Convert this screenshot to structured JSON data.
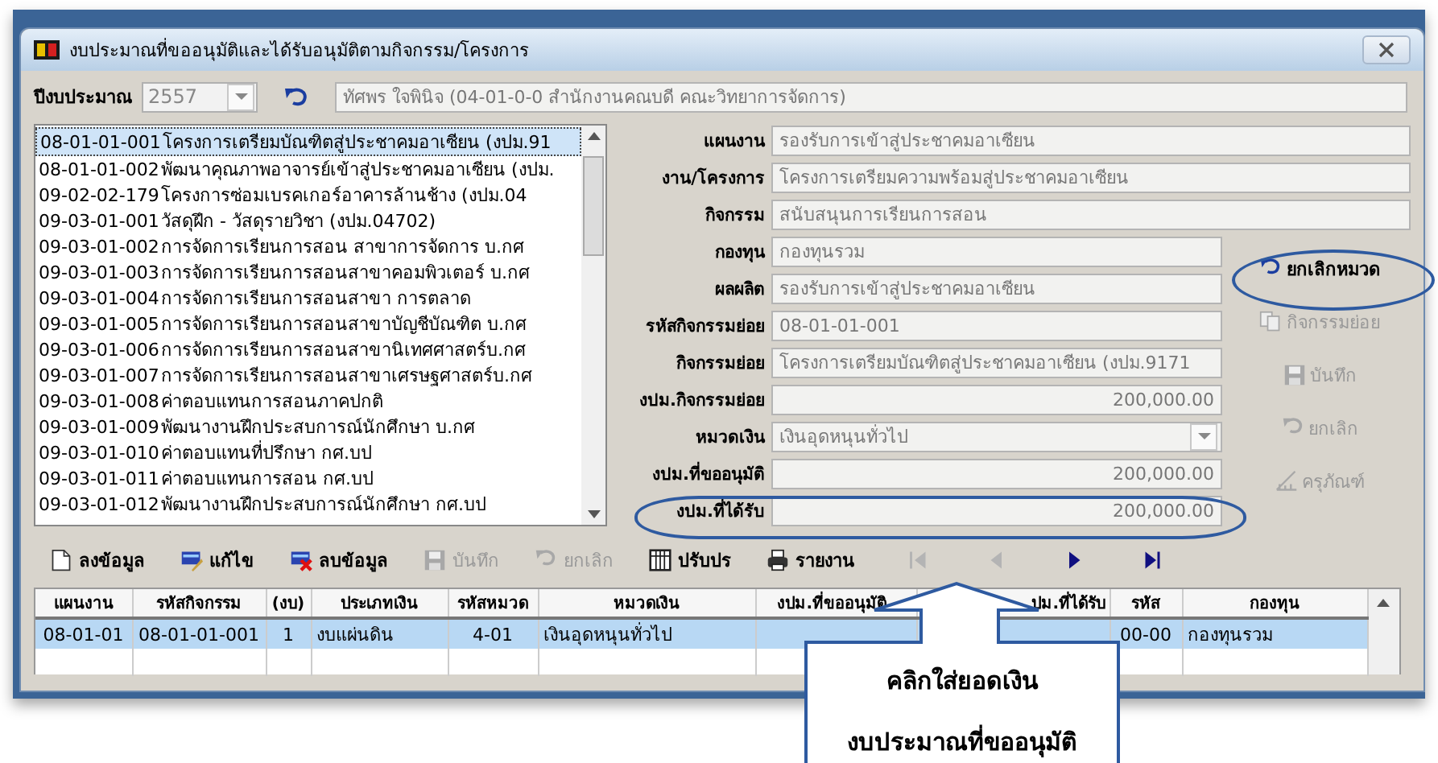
{
  "window": {
    "title": "งบประมาณที่ขออนุมัติและได้รับอนุมัติตามกิจกรรม/โครงการ"
  },
  "budget_year": {
    "label": "ปีงบประมาณ",
    "value": "2557",
    "user": "ทัศพร ใจพินิจ  (04-01-0-0 สำนักงานคณบดี คณะวิทยาการจัดการ)"
  },
  "activity_list": [
    {
      "code": "08-01-01-001",
      "name": "โครงการเตรียมบัณฑิตสู่ประชาคมอาเซียน (งปม.91",
      "selected": true
    },
    {
      "code": "08-01-01-002",
      "name": "พัฒนาคุณภาพอาจารย์เข้าสู่ประชาคมอาเซียน (งปม.",
      "selected": false
    },
    {
      "code": "09-02-02-179",
      "name": "โครงการซ่อมเบรคเกอร์อาคารล้านช้าง (งปม.04",
      "selected": false
    },
    {
      "code": "09-03-01-001",
      "name": "วัสดุฝึก - วัสดุรายวิชา (งปม.04702)",
      "selected": false
    },
    {
      "code": "09-03-01-002",
      "name": "การจัดการเรียนการสอน สาขาการจัดการ บ.กศ",
      "selected": false
    },
    {
      "code": "09-03-01-003",
      "name": "การจัดการเรียนการสอนสาขาคอมพิวเตอร์ บ.กศ",
      "selected": false
    },
    {
      "code": "09-03-01-004",
      "name": "การจัดการเรียนการสอนสาขา การตลาด",
      "selected": false
    },
    {
      "code": "09-03-01-005",
      "name": "การจัดการเรียนการสอนสาขาบัญชีบัณฑิต บ.กศ",
      "selected": false
    },
    {
      "code": "09-03-01-006",
      "name": "การจัดการเรียนการสอนสาขานิเทศศาสตร์บ.กศ",
      "selected": false
    },
    {
      "code": "09-03-01-007",
      "name": "การจัดการเรียนการสอนสาขาเศรษฐศาสตร์บ.กศ",
      "selected": false
    },
    {
      "code": "09-03-01-008",
      "name": "ค่าตอบแทนการสอนภาคปกติ",
      "selected": false
    },
    {
      "code": "09-03-01-009",
      "name": "พัฒนางานฝึกประสบการณ์นักศึกษา บ.กศ",
      "selected": false
    },
    {
      "code": "09-03-01-010",
      "name": "ค่าตอบแทนที่ปรึกษา กศ.บป",
      "selected": false
    },
    {
      "code": "09-03-01-011",
      "name": "ค่าตอบแทนการสอน กศ.บป",
      "selected": false
    },
    {
      "code": "09-03-01-012",
      "name": "พัฒนางานฝึกประสบการณ์นักศึกษา กศ.บป",
      "selected": false
    }
  ],
  "form_fields": [
    {
      "label": "แผนงาน",
      "value": "รองรับการเข้าสู่ประชาคมอาเซียน",
      "kind": "wide"
    },
    {
      "label": "งาน/โครงการ",
      "value": "โครงการเตรียมความพร้อมสู่ประชาคมอาเซียน",
      "kind": "wide"
    },
    {
      "label": "กิจกรรม",
      "value": "สนับสนุนการเรียนการสอน",
      "kind": "wide"
    },
    {
      "label": "กองทุน",
      "value": "กองทุนรวม",
      "kind": "text"
    },
    {
      "label": "ผลผลิต",
      "value": "รองรับการเข้าสู่ประชาคมอาเซียน",
      "kind": "text"
    },
    {
      "label": "รหัสกิจกรรมย่อย",
      "value": "08-01-01-001",
      "kind": "text"
    },
    {
      "label": "กิจกรรมย่อย",
      "value": "โครงการเตรียมบัณฑิตสู่ประชาคมอาเซียน (งปม.9171",
      "kind": "text"
    },
    {
      "label": "งปม.กิจกรรมย่อย",
      "value": "200,000.00",
      "kind": "number"
    },
    {
      "label": "หมวดเงิน",
      "value": "เงินอุดหนุนทั่วไป",
      "kind": "dropdown"
    },
    {
      "label": "งปม.ที่ขออนุมัติ",
      "value": "200,000.00",
      "kind": "number"
    },
    {
      "label": "งปม.ที่ได้รับ",
      "value": "200,000.00",
      "kind": "number"
    }
  ],
  "side_buttons": [
    {
      "label": "ยกเลิกหมวด",
      "disabled": false
    },
    {
      "label": "กิจกรรมย่อย",
      "disabled": true
    },
    {
      "label": "บันทึก",
      "disabled": true
    },
    {
      "label": "ยกเลิก",
      "disabled": true
    },
    {
      "label": "ครุภัณฑ์",
      "disabled": true
    }
  ],
  "toolbar": [
    {
      "label": "ลงข้อมูล",
      "disabled": false
    },
    {
      "label": "แก้ไข",
      "disabled": false
    },
    {
      "label": "ลบข้อมูล",
      "disabled": false
    },
    {
      "label": "บันทึก",
      "disabled": true
    },
    {
      "label": "ยกเลิก",
      "disabled": true
    },
    {
      "label": "ปรับปร",
      "disabled": false
    },
    {
      "label": "รายงาน",
      "disabled": false
    }
  ],
  "navigation": [
    {
      "kind": "first",
      "disabled": true
    },
    {
      "kind": "prev",
      "disabled": true
    },
    {
      "kind": "next",
      "disabled": false
    },
    {
      "kind": "last",
      "disabled": false
    }
  ],
  "table": {
    "columns": [
      "แผนงาน",
      "รหัสกิจกรรม",
      "(งบ)",
      "ประเภทเงิน",
      "รหัสหมวด",
      "หมวดเงิน",
      "งปม.ที่ขออนุมัติ",
      "ปม.ที่ได้รับ",
      "รหัส",
      "กองทุน"
    ],
    "rows": [
      {
        "selected": true,
        "cells": [
          "08-01-01",
          "08-01-01-001",
          "1",
          "งบแผ่นดิน",
          "4-01",
          "เงินอุดหนุนทั่วไป",
          "",
          "",
          "00-00",
          "กองทุนรวม"
        ]
      }
    ]
  },
  "callout": {
    "lines": [
      "คลิกใส่ยอดเงิน",
      "งบประมาณที่ขออนุมัติ"
    ]
  }
}
